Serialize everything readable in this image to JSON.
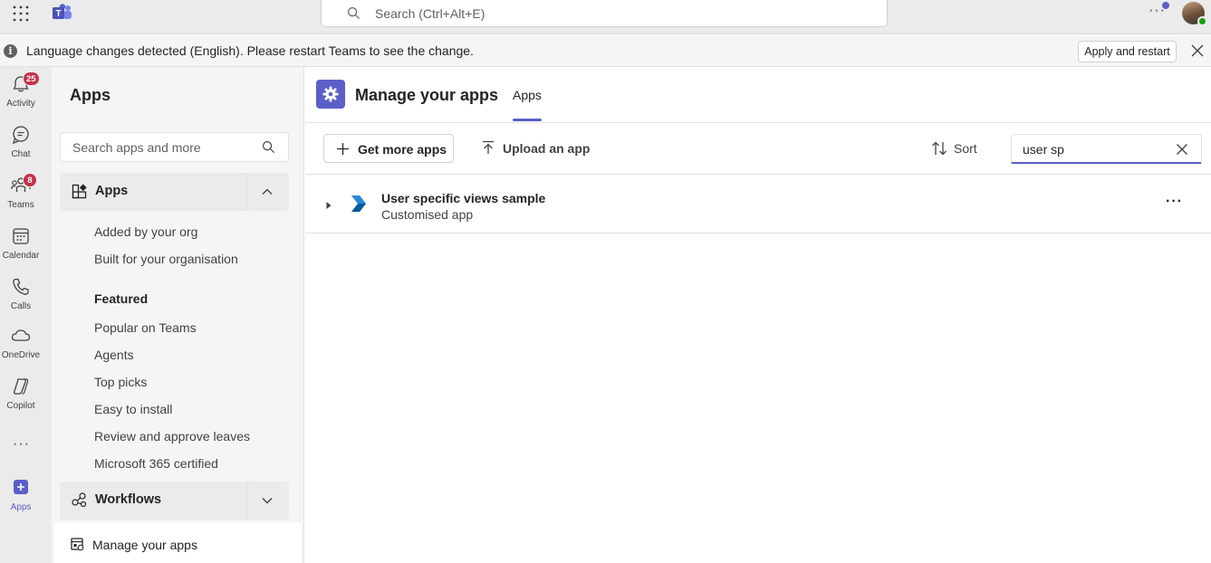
{
  "titlebar": {
    "search_placeholder": "Search (Ctrl+Alt+E)",
    "more_label": "···",
    "icons": [
      "waffle-icon",
      "teams-logo-icon",
      "search-icon",
      "more-icon",
      "avatar"
    ]
  },
  "banner": {
    "message": "Language changes detected (English). Please restart Teams to see the change.",
    "info_glyph": "i",
    "apply_label": "Apply and restart"
  },
  "rail": {
    "items": [
      {
        "label": "Activity",
        "badge": "25",
        "icon": "bell-icon"
      },
      {
        "label": "Chat",
        "icon": "chat-icon"
      },
      {
        "label": "Teams",
        "badge": "8",
        "icon": "teams-icon"
      },
      {
        "label": "Calendar",
        "icon": "calendar-icon"
      },
      {
        "label": "Calls",
        "icon": "phone-icon"
      },
      {
        "label": "OneDrive",
        "icon": "cloud-icon"
      },
      {
        "label": "Copilot",
        "icon": "copilot-icon"
      },
      {
        "label": "Apps",
        "icon": "plus-icon"
      }
    ],
    "more_label": "···"
  },
  "left_panel": {
    "title": "Apps",
    "search_placeholder": "Search apps and more",
    "apps_section": "Apps",
    "apps_items": [
      "Added by your org",
      "Built for your organisation"
    ],
    "featured_heading": "Featured",
    "featured_items": [
      "Popular on Teams",
      "Agents",
      "Top picks",
      "Easy to install",
      "Review and approve leaves",
      "Microsoft 365 certified"
    ],
    "workflows_section": "Workflows",
    "manage_label": "Manage your apps"
  },
  "main": {
    "title": "Manage your apps",
    "tab": "Apps",
    "toolbar": {
      "get_more": "Get more apps",
      "upload": "Upload an app",
      "sort": "Sort",
      "filter_value": "user sp"
    },
    "rows": [
      {
        "name": "User specific views sample",
        "type": "Customised app",
        "more": "···"
      }
    ]
  },
  "colors": {
    "accent": "#5b5fc7",
    "badge": "#c4314b",
    "presence": "#13a10e"
  }
}
